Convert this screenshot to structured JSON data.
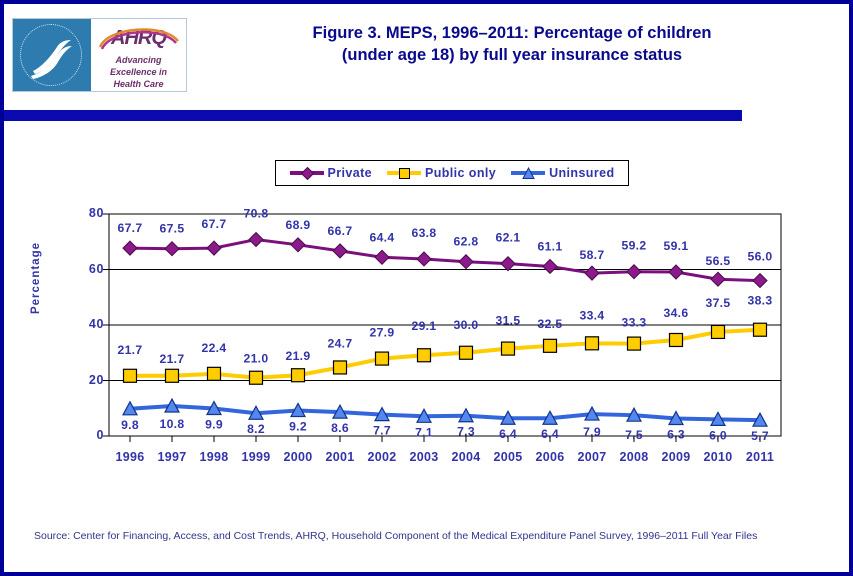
{
  "title": {
    "line1": "Figure 3. MEPS, 1996–2011: Percentage of children",
    "line2": "(under age 18) by full year insurance status"
  },
  "logo": {
    "agency": "AHRQ",
    "tagline_1": "Advancing",
    "tagline_2": "Excellence in",
    "tagline_3": "Health Care"
  },
  "footer": {
    "source": "Source: Center for Financing, Access, and Cost Trends, AHRQ, Household Component of the Medical Expenditure Panel Survey,  1996–2011 Full Year Files"
  },
  "colors": {
    "border": "#000099",
    "rule": "#0a0ab0",
    "title": "#0a0a8c",
    "axis_text": "#3333aa",
    "private": "#7B0F7B",
    "public": "#FFCC00",
    "uninsured": "#3366DD",
    "logo_seal": "#2e7bb0",
    "logo_purple": "#6b2d6b"
  },
  "chart_data": {
    "type": "line",
    "title": "Figure 3. MEPS, 1996–2011: Percentage of children (under age 18) by full year insurance status",
    "xlabel": "",
    "ylabel": "Percentage",
    "ylim": [
      0,
      80
    ],
    "yticks": [
      0,
      20,
      40,
      60,
      80
    ],
    "grid": true,
    "legend_position": "top-center",
    "categories": [
      "1996",
      "1997",
      "1998",
      "1999",
      "2000",
      "2001",
      "2002",
      "2003",
      "2004",
      "2005",
      "2006",
      "2007",
      "2008",
      "2009",
      "2010",
      "2011"
    ],
    "series": [
      {
        "name": "Private",
        "color": "#7B0F7B",
        "marker": "diamond",
        "values": [
          67.7,
          67.5,
          67.7,
          70.8,
          68.9,
          66.7,
          64.4,
          63.8,
          62.8,
          62.1,
          61.1,
          58.7,
          59.2,
          59.1,
          56.5,
          56.0
        ]
      },
      {
        "name": "Public only",
        "color": "#FFCC00",
        "marker": "square",
        "values": [
          21.7,
          21.7,
          22.4,
          21.0,
          21.9,
          24.7,
          27.9,
          29.1,
          30.0,
          31.5,
          32.5,
          33.4,
          33.3,
          34.6,
          37.5,
          38.3
        ]
      },
      {
        "name": "Uninsured",
        "color": "#3366DD",
        "marker": "triangle",
        "values": [
          9.8,
          10.8,
          9.9,
          8.2,
          9.2,
          8.6,
          7.7,
          7.1,
          7.3,
          6.4,
          6.4,
          7.9,
          7.5,
          6.3,
          6.0,
          5.7
        ]
      }
    ]
  }
}
